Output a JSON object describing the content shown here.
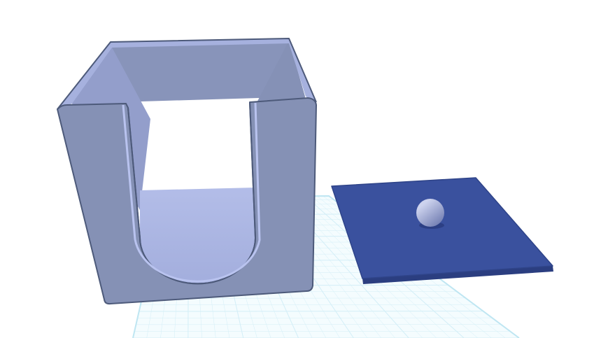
{
  "scene": {
    "background_color": "#ffffff",
    "workplane": {
      "fill_color": "#f4fcfe",
      "grid_color": "#d3eef7",
      "edge_color": "#bfe6f2"
    },
    "objects": [
      {
        "name": "open-box-with-u-cutout",
        "kind": "box",
        "front_color": "#8591b5",
        "interior_color": "#8793b8",
        "floor_color": "#a8b3e0",
        "top_color": "#a6b1de",
        "outline_color": "#4d5a7a"
      },
      {
        "name": "lid-plate",
        "kind": "plate",
        "top_color": "#3a519e",
        "edge_color": "#2b3e80"
      },
      {
        "name": "knob-sphere",
        "kind": "sphere",
        "light_color": "#cdd3ee",
        "dark_color": "#6f7bb0"
      }
    ]
  }
}
